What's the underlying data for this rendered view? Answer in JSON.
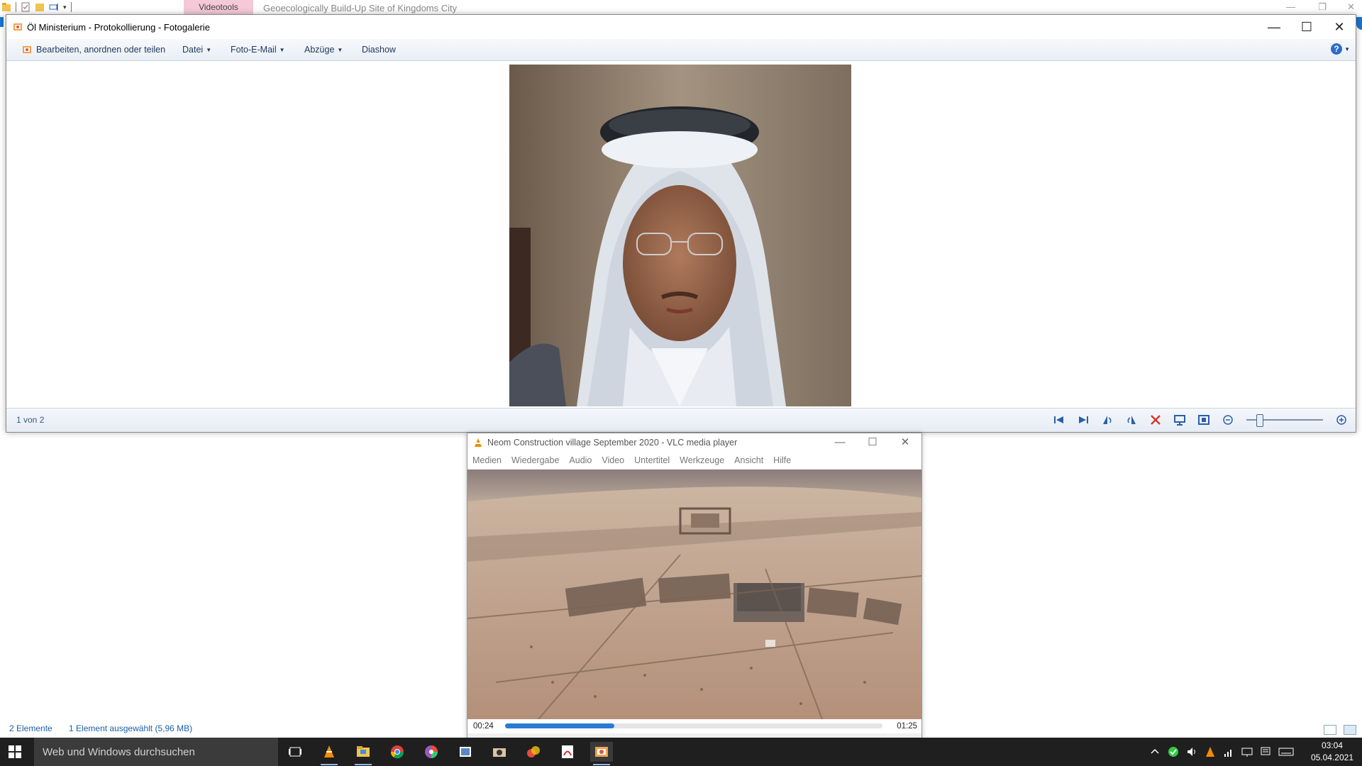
{
  "explorer": {
    "context_tab": "Videotools",
    "title": "Geoecologically Build-Up Site of Kingdoms City",
    "status_items": "2 Elemente",
    "status_selected": "1 Element ausgewählt (5,96 MB)"
  },
  "gallery": {
    "title": "Öl Ministerium - Protokollierung - Fotogalerie",
    "menu": {
      "edit": "Bearbeiten, anordnen oder teilen",
      "file": "Datei",
      "email": "Foto-E-Mail",
      "prints": "Abzüge",
      "slideshow": "Diashow"
    },
    "counter": "1 von 2"
  },
  "vlc": {
    "title": "Neom Construction village September  2020 - VLC media player",
    "menu": [
      "Medien",
      "Wiedergabe",
      "Audio",
      "Video",
      "Untertitel",
      "Werkzeuge",
      "Ansicht",
      "Hilfe"
    ],
    "elapsed": "00:24",
    "total": "01:25",
    "progress": 0.29
  },
  "taskbar": {
    "search_placeholder": "Web und Windows durchsuchen",
    "time": "03:04",
    "date": "05.04.2021"
  },
  "colors": {
    "accent": "#2a7bd4",
    "taskbar": "#1f1f1f",
    "context_tab": "#f5c9d8"
  }
}
